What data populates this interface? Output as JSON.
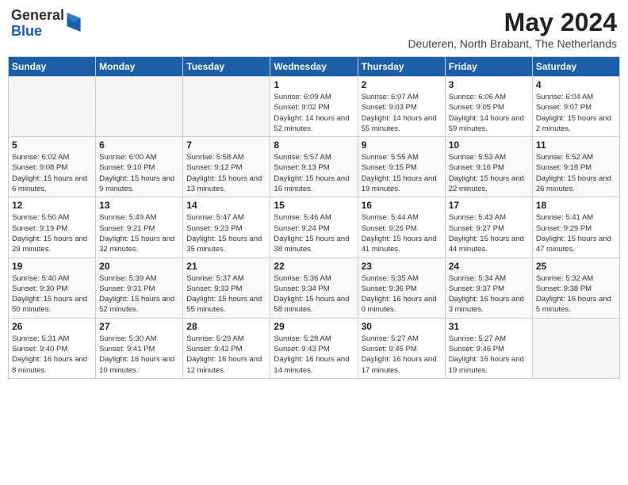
{
  "header": {
    "logo_general": "General",
    "logo_blue": "Blue",
    "title": "May 2024",
    "location": "Deuteren, North Brabant, The Netherlands"
  },
  "days_of_week": [
    "Sunday",
    "Monday",
    "Tuesday",
    "Wednesday",
    "Thursday",
    "Friday",
    "Saturday"
  ],
  "weeks": [
    [
      {
        "day": "",
        "info": ""
      },
      {
        "day": "",
        "info": ""
      },
      {
        "day": "",
        "info": ""
      },
      {
        "day": "1",
        "info": "Sunrise: 6:09 AM\nSunset: 9:02 PM\nDaylight: 14 hours and 52 minutes."
      },
      {
        "day": "2",
        "info": "Sunrise: 6:07 AM\nSunset: 9:03 PM\nDaylight: 14 hours and 55 minutes."
      },
      {
        "day": "3",
        "info": "Sunrise: 6:06 AM\nSunset: 9:05 PM\nDaylight: 14 hours and 59 minutes."
      },
      {
        "day": "4",
        "info": "Sunrise: 6:04 AM\nSunset: 9:07 PM\nDaylight: 15 hours and 2 minutes."
      }
    ],
    [
      {
        "day": "5",
        "info": "Sunrise: 6:02 AM\nSunset: 9:08 PM\nDaylight: 15 hours and 6 minutes."
      },
      {
        "day": "6",
        "info": "Sunrise: 6:00 AM\nSunset: 9:10 PM\nDaylight: 15 hours and 9 minutes."
      },
      {
        "day": "7",
        "info": "Sunrise: 5:58 AM\nSunset: 9:12 PM\nDaylight: 15 hours and 13 minutes."
      },
      {
        "day": "8",
        "info": "Sunrise: 5:57 AM\nSunset: 9:13 PM\nDaylight: 15 hours and 16 minutes."
      },
      {
        "day": "9",
        "info": "Sunrise: 5:55 AM\nSunset: 9:15 PM\nDaylight: 15 hours and 19 minutes."
      },
      {
        "day": "10",
        "info": "Sunrise: 5:53 AM\nSunset: 9:16 PM\nDaylight: 15 hours and 22 minutes."
      },
      {
        "day": "11",
        "info": "Sunrise: 5:52 AM\nSunset: 9:18 PM\nDaylight: 15 hours and 26 minutes."
      }
    ],
    [
      {
        "day": "12",
        "info": "Sunrise: 5:50 AM\nSunset: 9:19 PM\nDaylight: 15 hours and 29 minutes."
      },
      {
        "day": "13",
        "info": "Sunrise: 5:49 AM\nSunset: 9:21 PM\nDaylight: 15 hours and 32 minutes."
      },
      {
        "day": "14",
        "info": "Sunrise: 5:47 AM\nSunset: 9:23 PM\nDaylight: 15 hours and 35 minutes."
      },
      {
        "day": "15",
        "info": "Sunrise: 5:46 AM\nSunset: 9:24 PM\nDaylight: 15 hours and 38 minutes."
      },
      {
        "day": "16",
        "info": "Sunrise: 5:44 AM\nSunset: 9:26 PM\nDaylight: 15 hours and 41 minutes."
      },
      {
        "day": "17",
        "info": "Sunrise: 5:43 AM\nSunset: 9:27 PM\nDaylight: 15 hours and 44 minutes."
      },
      {
        "day": "18",
        "info": "Sunrise: 5:41 AM\nSunset: 9:29 PM\nDaylight: 15 hours and 47 minutes."
      }
    ],
    [
      {
        "day": "19",
        "info": "Sunrise: 5:40 AM\nSunset: 9:30 PM\nDaylight: 15 hours and 50 minutes."
      },
      {
        "day": "20",
        "info": "Sunrise: 5:39 AM\nSunset: 9:31 PM\nDaylight: 15 hours and 52 minutes."
      },
      {
        "day": "21",
        "info": "Sunrise: 5:37 AM\nSunset: 9:33 PM\nDaylight: 15 hours and 55 minutes."
      },
      {
        "day": "22",
        "info": "Sunrise: 5:36 AM\nSunset: 9:34 PM\nDaylight: 15 hours and 58 minutes."
      },
      {
        "day": "23",
        "info": "Sunrise: 5:35 AM\nSunset: 9:36 PM\nDaylight: 16 hours and 0 minutes."
      },
      {
        "day": "24",
        "info": "Sunrise: 5:34 AM\nSunset: 9:37 PM\nDaylight: 16 hours and 3 minutes."
      },
      {
        "day": "25",
        "info": "Sunrise: 5:32 AM\nSunset: 9:38 PM\nDaylight: 16 hours and 5 minutes."
      }
    ],
    [
      {
        "day": "26",
        "info": "Sunrise: 5:31 AM\nSunset: 9:40 PM\nDaylight: 16 hours and 8 minutes."
      },
      {
        "day": "27",
        "info": "Sunrise: 5:30 AM\nSunset: 9:41 PM\nDaylight: 16 hours and 10 minutes."
      },
      {
        "day": "28",
        "info": "Sunrise: 5:29 AM\nSunset: 9:42 PM\nDaylight: 16 hours and 12 minutes."
      },
      {
        "day": "29",
        "info": "Sunrise: 5:28 AM\nSunset: 9:43 PM\nDaylight: 16 hours and 14 minutes."
      },
      {
        "day": "30",
        "info": "Sunrise: 5:27 AM\nSunset: 9:45 PM\nDaylight: 16 hours and 17 minutes."
      },
      {
        "day": "31",
        "info": "Sunrise: 5:27 AM\nSunset: 9:46 PM\nDaylight: 16 hours and 19 minutes."
      },
      {
        "day": "",
        "info": ""
      }
    ]
  ]
}
